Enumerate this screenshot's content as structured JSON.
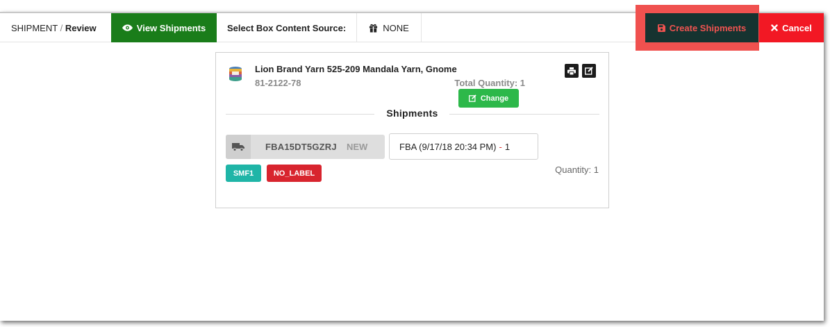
{
  "header": {
    "breadcrumb_root": "SHIPMENT",
    "breadcrumb_sep": "/",
    "breadcrumb_current": "Review",
    "view_shipments_label": "View Shipments",
    "box_source_label": "Select Box Content Source:",
    "box_source_value": "NONE",
    "create_label": "Create Shipments",
    "cancel_label": "Cancel"
  },
  "product": {
    "name": "Lion Brand Yarn 525-209 Mandala Yarn, Gnome",
    "sku": "81-2122-78",
    "total_quantity": "Total Quantity: 1",
    "change_label": "Change"
  },
  "shipments": {
    "title": "Shipments",
    "items": [
      {
        "id": "FBA15DT5GZRJ",
        "status": "NEW",
        "fba_label": "FBA (9/17/18 20:34 PM)",
        "fba_dash": "-",
        "fba_count": "1",
        "quantity": "Quantity: 1",
        "tags": [
          "SMF1",
          "NO_LABEL"
        ]
      }
    ]
  },
  "colors": {
    "view_green": "#1a7d1a",
    "create_dark": "#163330",
    "highlight_red": "#f0514f",
    "cancel_red": "#f21824",
    "change_green": "#2db84a",
    "tag_teal": "#1fb5a7",
    "tag_red": "#d8242e"
  },
  "icons": {
    "view": "eye-icon",
    "box_source": "gift-icon",
    "create": "save-icon",
    "cancel": "close-icon",
    "print": "print-icon",
    "edit": "edit-icon",
    "change": "edit-icon",
    "truck": "truck-icon"
  }
}
